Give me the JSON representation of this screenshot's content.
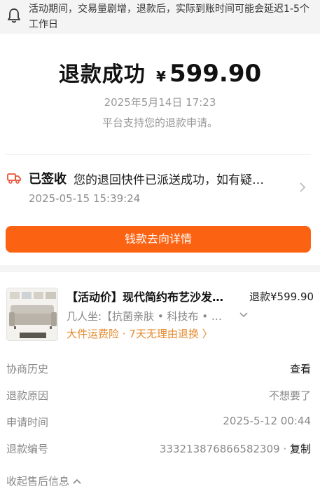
{
  "notice": {
    "icon": "bell-icon",
    "text": "活动期间，交易量剧增，退款后，实际到账时间可能会延迟1-5个工作日"
  },
  "refund": {
    "title": "退款成功",
    "currency": "¥",
    "amount": "599.90",
    "date": "2025年5月14日 17:23",
    "support_text": "平台支持您的退款申请。"
  },
  "logistics": {
    "icon": "truck-icon",
    "status": "已签收",
    "description": "您的退回快件已派送成功，如有疑…",
    "time": "2025-05-15 15:39:24"
  },
  "flow_button": "钱款去向详情",
  "product": {
    "title": "【活动价】现代简约布艺沙发…",
    "price": "退款¥599.90",
    "spec": "几人坐:【抗菌亲肤 • 科技布 • …",
    "services": "大件运费险 · 7天无理由退换 〉"
  },
  "details": [
    {
      "key": "协商历史",
      "value": "查看"
    },
    {
      "key": "退款原因",
      "value": "不想要了"
    },
    {
      "key": "申请时间",
      "value": "2025-5-12 00:44"
    },
    {
      "key": "退款编号",
      "value": "333213876866582309",
      "action": "复制"
    }
  ],
  "collapse_label": "收起售后信息",
  "colors": {
    "accent": "#fb6312",
    "service_orange": "#e68a2e",
    "logistics_red": "#e8543a",
    "muted": "#888888"
  }
}
